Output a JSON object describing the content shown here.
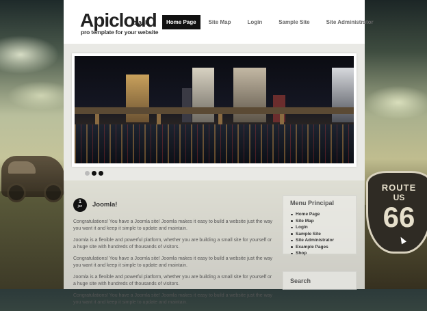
{
  "logo": {
    "name": "Apicloud",
    "variant": "black",
    "tagline": "pro template for your website"
  },
  "nav": {
    "items": [
      {
        "label": "Home Page",
        "active": true
      },
      {
        "label": "Site Map",
        "active": false
      },
      {
        "label": "Login",
        "active": false
      },
      {
        "label": "Sample Site",
        "active": false
      },
      {
        "label": "Site Administrator",
        "active": false
      }
    ]
  },
  "slider": {
    "active_dot": 2,
    "dot_count": 3
  },
  "article": {
    "date_day": "1",
    "date_month": "jan",
    "title": "Joomla!",
    "paragraphs": [
      "Congratulations! You have a Joomla site! Joomla makes it easy to build a website just the way you want it and keep it simple to update and maintain.",
      "Joomla is a flexible and powerful platform, whether you are building a small site for yourself or a huge site with hundreds of thousands of visitors.",
      "Congratulations! You have a Joomla site! Joomla makes it easy to build a website just the way you want it and keep it simple to update and maintain.",
      "Joomla is a flexible and powerful platform, whether you are building a small site for yourself or a huge site with hundreds of thousands of visitors.",
      "Congratulations! You have a Joomla site! Joomla makes it easy to build a website just the way you want it and keep it simple to update and maintain."
    ]
  },
  "sidebar": {
    "menu_title": "Menu Principal",
    "menu_items": [
      "Home Page",
      "Site Map",
      "Login",
      "Sample Site",
      "Site Administrator",
      "Example Pages",
      "Shop"
    ],
    "search_title": "Search"
  },
  "background": {
    "sign_line1": "ROUTE",
    "sign_line2": "US",
    "sign_number": "66"
  }
}
